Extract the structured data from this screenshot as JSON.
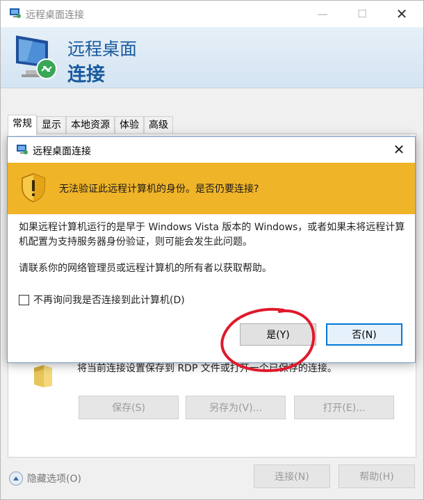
{
  "window": {
    "title": "远程桌面连接",
    "minimize_glyph": "—",
    "maximize_glyph": "☐",
    "close_glyph": "✕"
  },
  "banner": {
    "line1": "远程桌面",
    "line2": "连接"
  },
  "tabs": [
    {
      "label": "常规",
      "active": true
    },
    {
      "label": "显示"
    },
    {
      "label": "本地资源"
    },
    {
      "label": "体验"
    },
    {
      "label": "高级"
    }
  ],
  "save_section": {
    "description": "将当前连接设置保存到 RDP 文件或打开一个已保存的连接。",
    "save_label": "保存(S)",
    "save_as_label": "另存为(V)...",
    "open_label": "打开(E)..."
  },
  "footer": {
    "options_label": "隐藏选项(O)",
    "connect_label": "连接(N)",
    "help_label": "帮助(H)"
  },
  "dialog": {
    "title": "远程桌面连接",
    "close_glyph": "✕",
    "warning": "无法验证此远程计算机的身份。是否仍要连接?",
    "body_line1": "如果远程计算机运行的是早于 Windows Vista 版本的 Windows，或者如果未将远程计算机配置为支持服务器身份验证，则可能会发生此问题。",
    "body_line2": "请联系你的网络管理员或远程计算机的所有者以获取帮助。",
    "checkbox_label": "不再询问我是否连接到此计算机(D)",
    "yes_label": "是(Y)",
    "no_label": "否(N)",
    "accent": "#f0b429",
    "annotation_color": "#e0192b"
  }
}
